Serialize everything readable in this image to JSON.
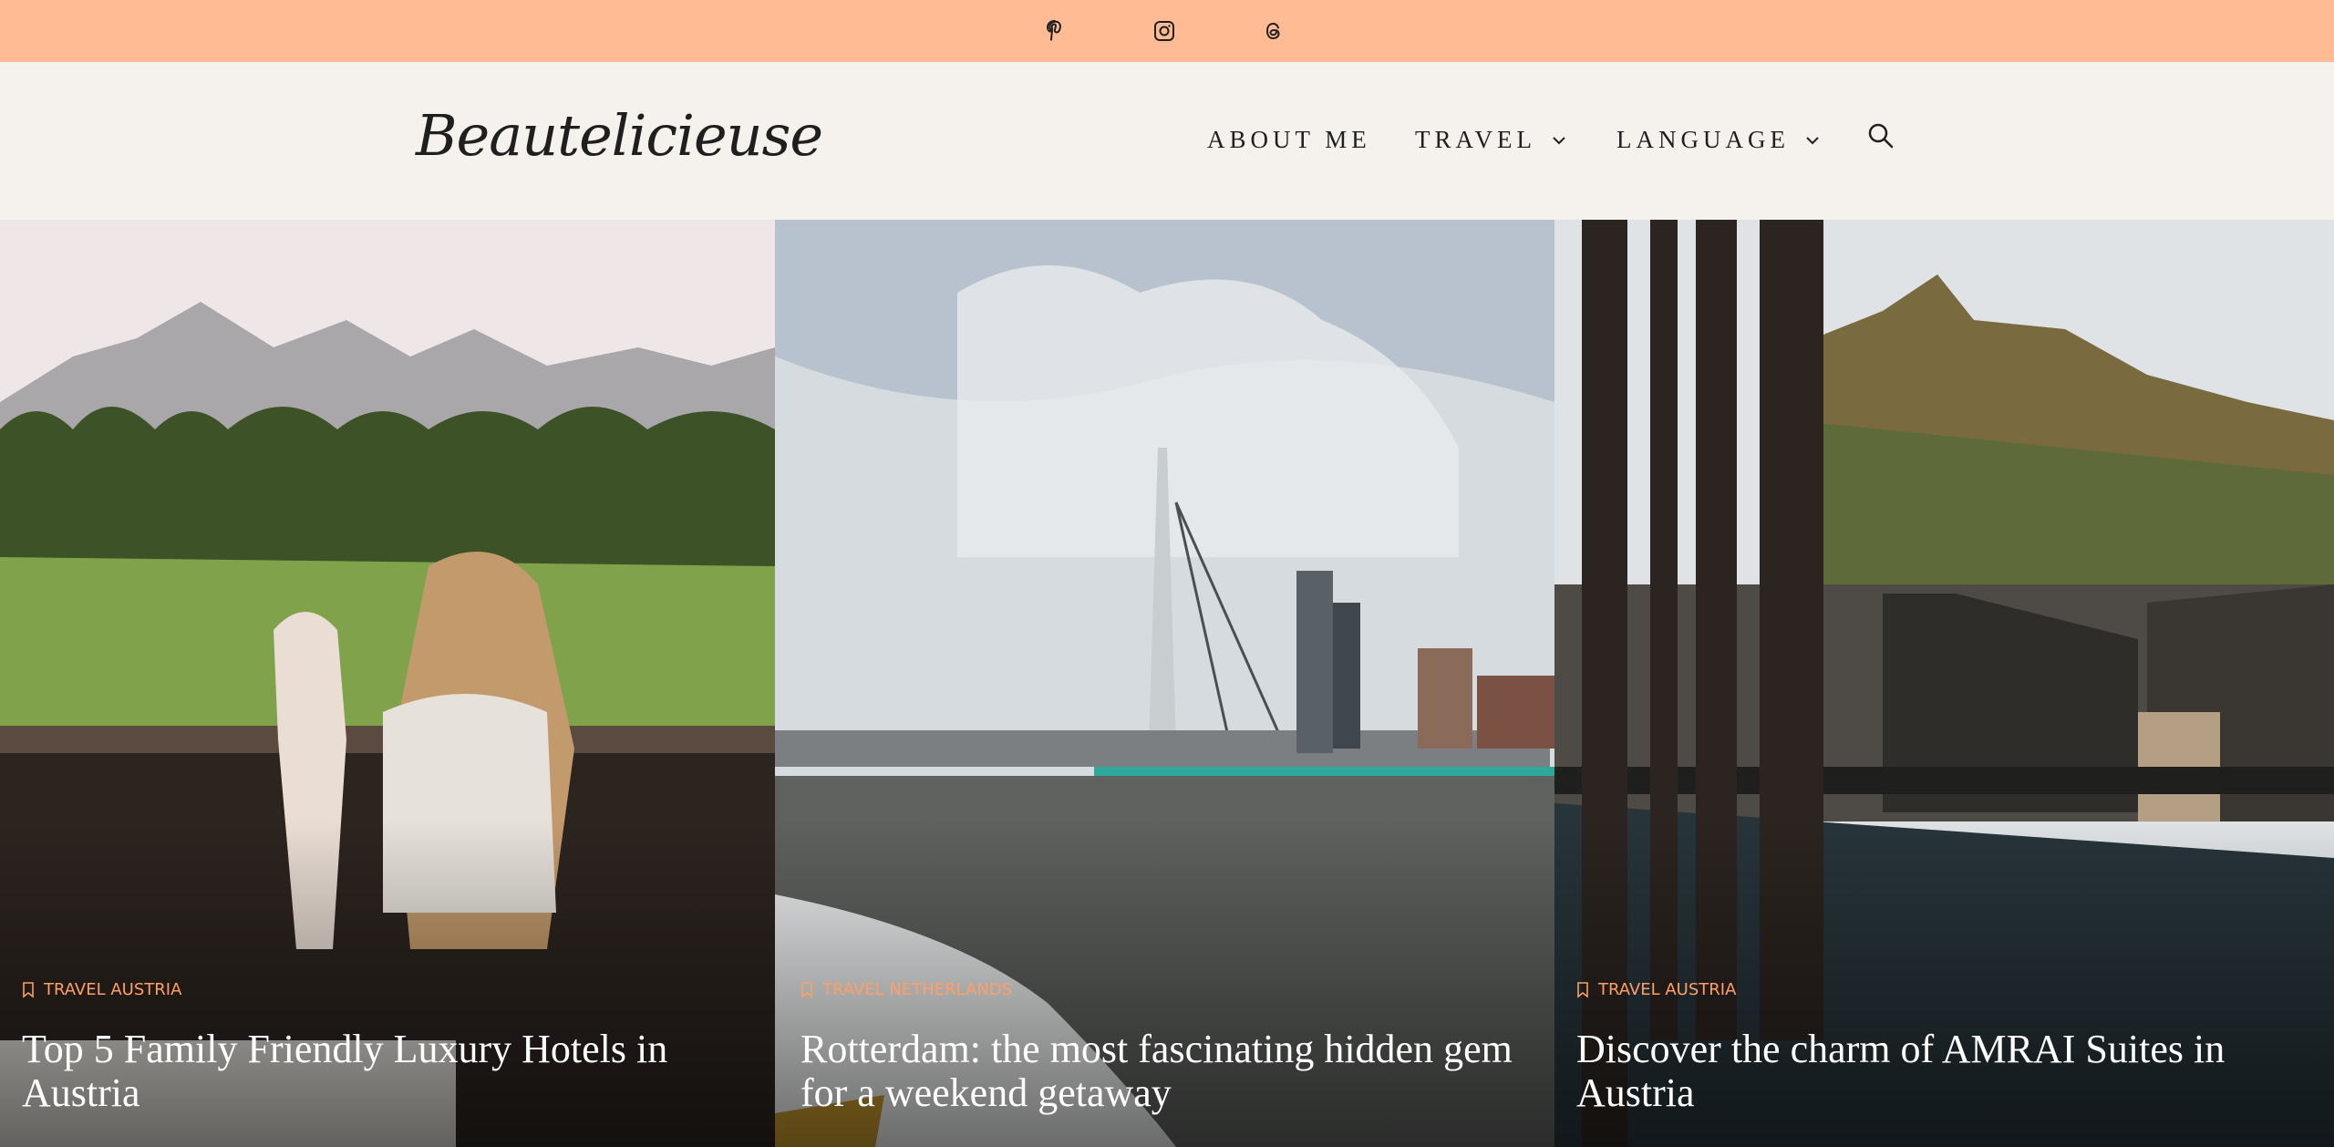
{
  "topbar": {
    "background": "#ffbb94",
    "social_icons": [
      "pinterest-icon",
      "instagram-icon",
      "threads-icon"
    ]
  },
  "header": {
    "logo": "Beautelicieuse",
    "nav": [
      {
        "label": "ABOUT ME",
        "has_dropdown": false
      },
      {
        "label": "TRAVEL",
        "has_dropdown": true
      },
      {
        "label": "LANGUAGE",
        "has_dropdown": true
      }
    ],
    "search_icon": "search-icon"
  },
  "posts": [
    {
      "category": "TRAVEL AUSTRIA",
      "title": "Top 5 Family Friendly Luxury Hotels in Austria"
    },
    {
      "category": "TRAVEL NETHERLANDS",
      "title": "Rotterdam: the most fascinating hidden gem for a weekend getaway"
    },
    {
      "category": "TRAVEL AUSTRIA",
      "title": "Discover the charm of AMRAI Suites in Austria"
    }
  ],
  "colors": {
    "accent": "#ff9f66",
    "header_bg": "#f5f1ec"
  }
}
